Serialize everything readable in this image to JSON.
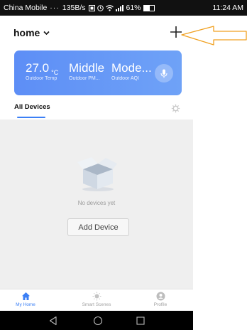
{
  "status_bar": {
    "carrier": "China Mobile",
    "dots": "···",
    "speed": "135B/s",
    "battery_pct": "61%",
    "battery_level": 0.61,
    "time": "11:24 AM",
    "icons": [
      "sim-icon",
      "clock-icon",
      "wifi-icon",
      "signal-icon",
      "battery-icon"
    ]
  },
  "header": {
    "home_label": "home",
    "add_icon": "plus-icon"
  },
  "weather": {
    "temp_value": "27.0",
    "temp_unit": "°C",
    "temp_label": "Outdoor Temp",
    "pm_value": "Middle",
    "pm_label": "Outdoor PM...",
    "aqi_value": "Mode...",
    "aqi_label": "Outdoor AQI",
    "mic_icon": "microphone-icon",
    "gradient_start": "#5d8ef6",
    "gradient_end": "#6fa2f7"
  },
  "tabs": {
    "all_devices": "All Devices",
    "accent": "#3b7ff5"
  },
  "empty_state": {
    "message": "No devices yet",
    "button_label": "Add Device"
  },
  "bottom_nav": [
    {
      "label": "My Home",
      "icon": "home-icon",
      "active": true
    },
    {
      "label": "Smart Scenes",
      "icon": "sun-icon",
      "active": false
    },
    {
      "label": "Profile",
      "icon": "profile-icon",
      "active": false
    }
  ],
  "system_nav": [
    "back-icon",
    "home-circle-icon",
    "recents-icon"
  ]
}
